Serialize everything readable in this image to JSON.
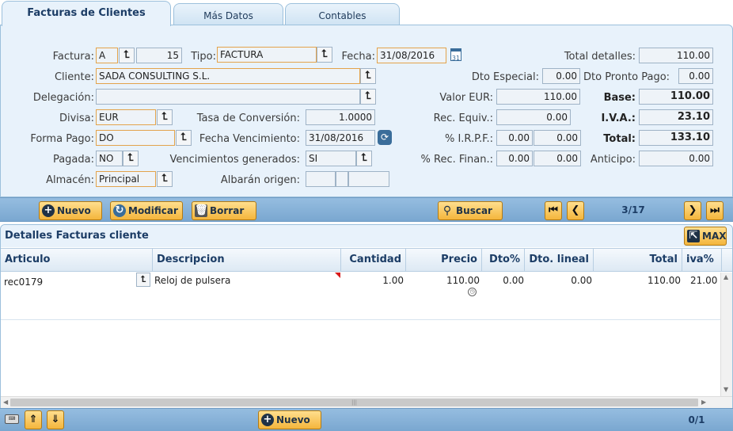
{
  "tabs": [
    "Facturas de Clientes",
    "Más Datos",
    "Contables"
  ],
  "form": {
    "factura_label": "Factura:",
    "factura_serie": "A",
    "factura_num": "15",
    "tipo_label": "Tipo:",
    "tipo_value": "FACTURA",
    "fecha_label": "Fecha:",
    "fecha_value": "31/08/2016",
    "cliente_label": "Cliente:",
    "cliente_value": "SADA CONSULTING S.L.",
    "delegacion_label": "Delegación:",
    "delegacion_value": "",
    "divisa_label": "Divisa:",
    "divisa_value": "EUR",
    "tasa_label": "Tasa de Conversión:",
    "tasa_value": "1.0000",
    "formapago_label": "Forma Pago:",
    "formapago_value": "DO",
    "fechavenc_label": "Fecha Vencimiento:",
    "fechavenc_value": "31/08/2016",
    "pagada_label": "Pagada:",
    "pagada_value": "NO",
    "vencgen_label": "Vencimientos generados:",
    "vencgen_value": "SI",
    "almacen_label": "Almacén:",
    "almacen_value": "Principal",
    "albaran_label": "Albarán origen:"
  },
  "totals": {
    "total_detalles_label": "Total detalles:",
    "total_detalles": "110.00",
    "dto_especial_label": "Dto Especial:",
    "dto_especial": "0.00",
    "dto_pronto_label": "Dto Pronto Pago:",
    "dto_pronto": "0.00",
    "valor_eur_label": "Valor EUR:",
    "valor_eur": "110.00",
    "base_label": "Base:",
    "base": "110.00",
    "rec_equiv_label": "Rec. Equiv.:",
    "rec_equiv": "0.00",
    "iva_label": "I.V.A.:",
    "iva": "23.10",
    "irpf_label": "% I.R.P.F.:",
    "irpf_pct": "0.00",
    "irpf": "0.00",
    "total_label": "Total:",
    "total": "133.10",
    "rec_finan_label": "% Rec. Finan.:",
    "rec_finan_pct": "0.00",
    "rec_finan": "0.00",
    "anticipo_label": "Anticipo:",
    "anticipo": "0.00"
  },
  "toolbar": {
    "nuevo": "Nuevo",
    "modificar": "Modificar",
    "borrar": "Borrar",
    "buscar": "Buscar",
    "pager": "3/17"
  },
  "detail": {
    "title": "Detalles Facturas cliente",
    "max_label": "MAX",
    "columns": [
      "Articulo",
      "Descripcion",
      "Cantidad",
      "Precio",
      "Dto%",
      "Dto. lineal",
      "Total",
      "iva%"
    ],
    "row": {
      "articulo": "rec0179",
      "descripcion": "Reloj de pulsera",
      "cantidad": "1.00",
      "precio": "110.00",
      "dto": "0.00",
      "dto_lineal": "0.00",
      "total": "110.00",
      "iva": "21.00"
    }
  },
  "footer": {
    "nuevo": "Nuevo",
    "pager": "0/1"
  },
  "icons": {
    "lookup": "lookup-icon",
    "calendar": "calendar-icon",
    "refresh": "refresh-icon"
  }
}
